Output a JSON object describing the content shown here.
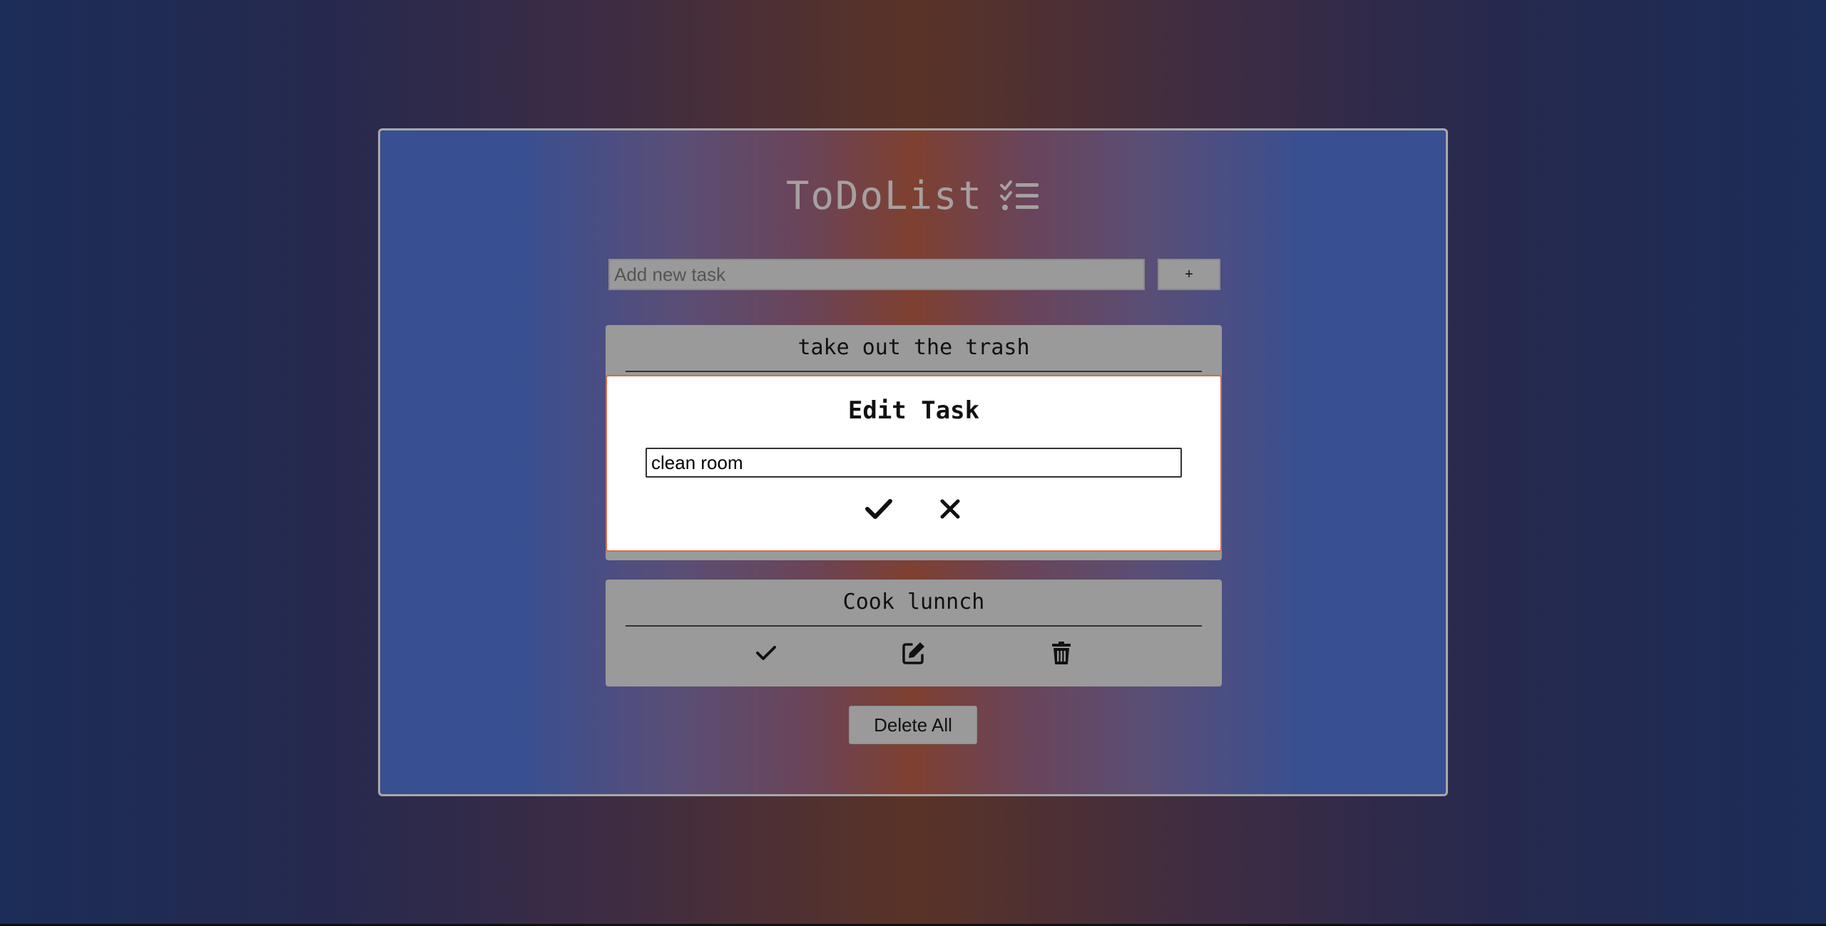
{
  "app": {
    "title": "ToDoList",
    "title_icon": "list-check-icon"
  },
  "add_task": {
    "placeholder": "Add new task",
    "button_label": "+"
  },
  "tasks": [
    {
      "text": "take out the trash"
    },
    {
      "text": "Cook lunnch",
      "actions": [
        "check-icon",
        "edit-icon",
        "trash-icon"
      ]
    }
  ],
  "edit_modal": {
    "title": "Edit Task",
    "input_value": "clean room",
    "actions": [
      "check-icon",
      "close-icon"
    ]
  },
  "delete_all_label": "Delete All",
  "colors": {
    "card_border": "#a8a8a8",
    "task_bg": "#9a9a9a",
    "modal_border": "#d9694a",
    "title_color": "#a6a0a0"
  }
}
